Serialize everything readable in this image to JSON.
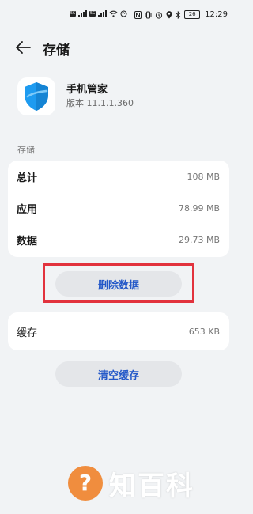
{
  "status_bar": {
    "time": "12:29",
    "battery": "26",
    "network_chip_1": "5G",
    "network_chip_2": "5G"
  },
  "header": {
    "title": "存储"
  },
  "app": {
    "name": "手机管家",
    "version": "版本 11.1.1.360"
  },
  "storage": {
    "section_label": "存储",
    "rows": [
      {
        "label": "总计",
        "value": "108 MB"
      },
      {
        "label": "应用",
        "value": "78.99 MB"
      },
      {
        "label": "数据",
        "value": "29.73 MB"
      }
    ],
    "delete_button": "删除数据"
  },
  "cache": {
    "label": "缓存",
    "value": "653 KB",
    "clear_button": "清空缓存"
  },
  "watermark": {
    "text": "知百科",
    "symbol": "?"
  },
  "colors": {
    "background": "#f1f3f5",
    "accent": "#2458c8",
    "highlight": "#e2323d",
    "shield": "#1e9bf0"
  }
}
